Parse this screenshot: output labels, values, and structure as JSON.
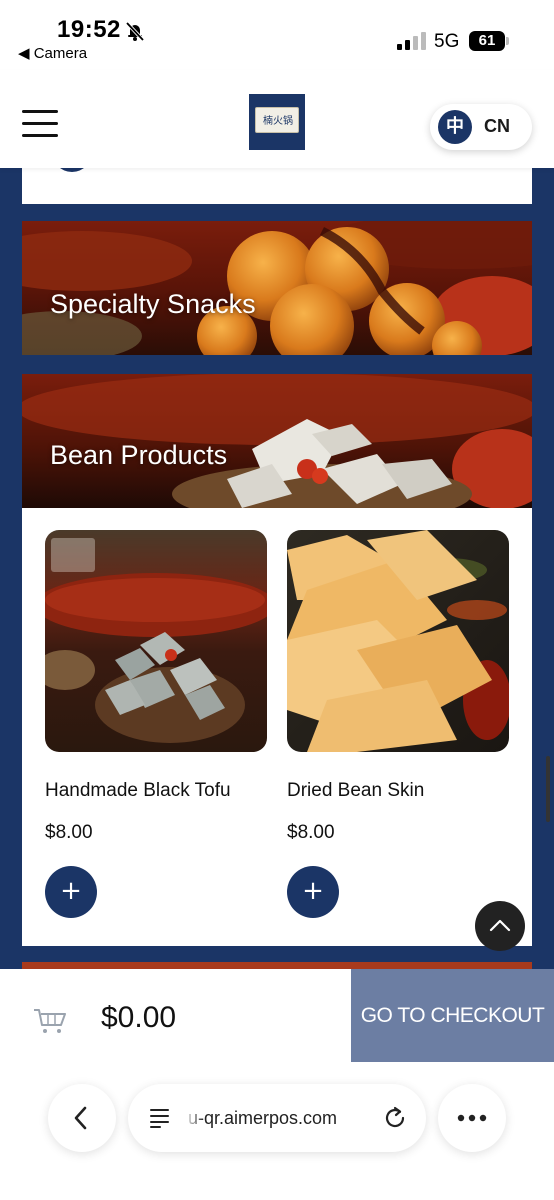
{
  "status_bar": {
    "time": "19:52",
    "back_app": "◀ Camera",
    "network": "5G",
    "battery": "61"
  },
  "header": {
    "logo_text": "楠火锅",
    "lang_char": "中",
    "lang_code": "CN"
  },
  "categories": [
    {
      "title": "Specialty Snacks"
    },
    {
      "title": "Bean Products"
    }
  ],
  "products": [
    {
      "name": "Handmade Black Tofu",
      "price": "$8.00",
      "add_label": "+"
    },
    {
      "name": "Dried Bean Skin",
      "price": "$8.00",
      "add_label": "+"
    }
  ],
  "cart": {
    "total": "$0.00",
    "checkout_label": "GO TO CHECKOUT"
  },
  "browser": {
    "url": "u-qr.aimerpos.com"
  },
  "colors": {
    "brand_navy": "#1b3566",
    "checkout_button": "#6c7ea3"
  },
  "icons": [
    "bell-slash-icon",
    "signal-icon",
    "battery-icon",
    "menu-icon",
    "cart-icon",
    "chevron-up-icon",
    "chevron-left-icon",
    "reader-icon",
    "reload-icon",
    "more-icon"
  ]
}
